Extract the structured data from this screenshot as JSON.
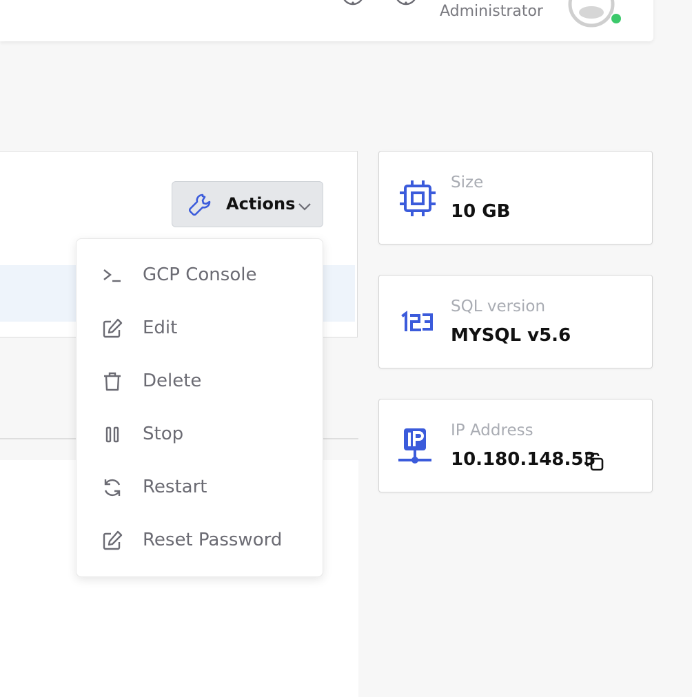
{
  "header": {
    "role": "Administrator",
    "icons": [
      "info-icon",
      "help-icon",
      "avatar"
    ],
    "status_color": "#3cc96b"
  },
  "actions": {
    "label": "Actions",
    "icon": "wrench-icon",
    "menu": [
      {
        "label": "GCP Console",
        "icon": "terminal-icon"
      },
      {
        "label": "Edit",
        "icon": "edit-icon"
      },
      {
        "label": "Delete",
        "icon": "trash-icon"
      },
      {
        "label": "Stop",
        "icon": "pause-icon"
      },
      {
        "label": "Restart",
        "icon": "restart-icon"
      },
      {
        "label": "Reset Password",
        "icon": "edit-icon"
      }
    ]
  },
  "cards": [
    {
      "label": "Size",
      "value": "10 GB",
      "icon": "cpu-icon"
    },
    {
      "label": "SQL version",
      "value": "MYSQL v5.6",
      "icon": "numbers-icon"
    },
    {
      "label": "IP Address",
      "value": "10.180.148.53",
      "icon": "ip-network-icon"
    }
  ],
  "colors": {
    "accent": "#3b5bdb",
    "selected_row": "#eef4fb"
  }
}
